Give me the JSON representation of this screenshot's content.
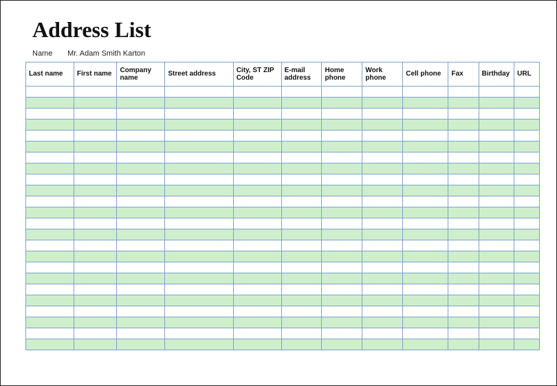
{
  "title": "Address List",
  "name_label": "Name",
  "name_value": "Mr. Adam Smith Karton",
  "columns": [
    "Last name",
    "First name",
    "Company name",
    "Street address",
    "City, ST  ZIP Code",
    "E-mail address",
    "Home phone",
    "Work phone",
    "Cell phone",
    "Fax",
    "Birthday",
    "URL"
  ],
  "row_count": 24,
  "colors": {
    "grid_border": "#7aa2c9",
    "stripe": "#cfeecc"
  }
}
